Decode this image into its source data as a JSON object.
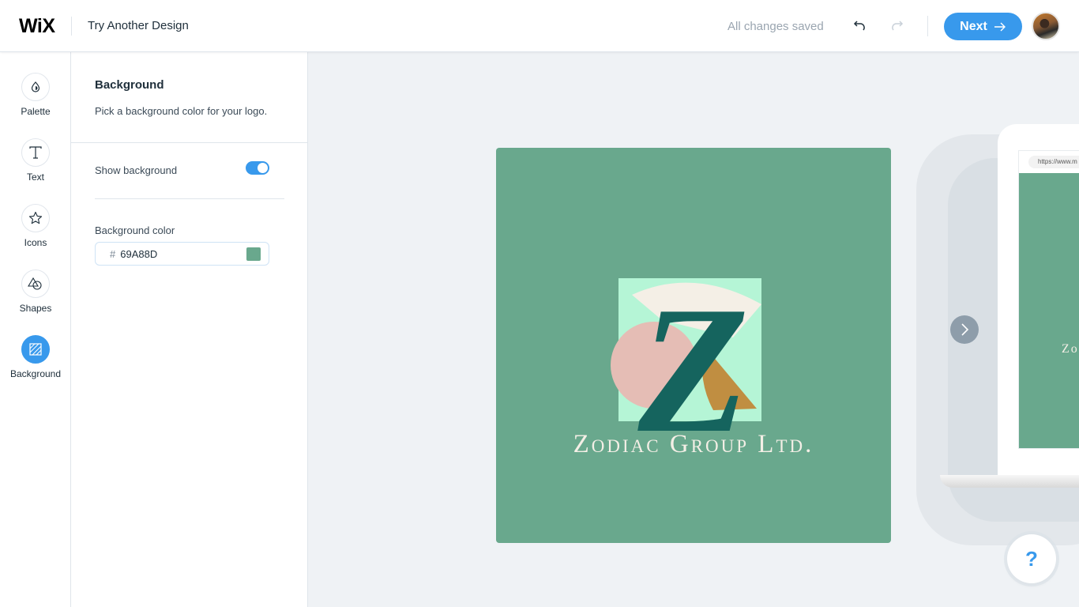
{
  "app": {
    "brand": "WiX",
    "page_title": "Try Another Design"
  },
  "topbar": {
    "save_status": "All changes saved",
    "undo_icon": "undo-icon",
    "redo_icon": "redo-icon",
    "next_label": "Next",
    "next_icon": "arrow-right-icon",
    "avatar": "user-avatar"
  },
  "sidebar": {
    "items": [
      {
        "label": "Palette",
        "icon": "palette-drop-icon",
        "active": false
      },
      {
        "label": "Text",
        "icon": "text-icon",
        "active": false
      },
      {
        "label": "Icons",
        "icon": "star-icon",
        "active": false
      },
      {
        "label": "Shapes",
        "icon": "shapes-icon",
        "active": false
      },
      {
        "label": "Background",
        "icon": "background-hatch-icon",
        "active": true
      }
    ]
  },
  "panel": {
    "title": "Background",
    "description": "Pick a background color for your logo.",
    "show_background_label": "Show background",
    "show_background_on": true,
    "background_color_label": "Background color",
    "hash": "#",
    "background_color_value": "69A88D"
  },
  "colors": {
    "accent": "#3899ec",
    "logo_background": "#69A88D",
    "logo_square": "#b5f5d6",
    "logo_fan": "#f4efe6",
    "logo_circle": "#e5bdb5",
    "logo_triangle": "#c08e41",
    "logo_letter": "#15645e",
    "logo_text": "#f4efe6"
  },
  "logo": {
    "letter": "Z",
    "brand_name": "Zodiac Group Ltd."
  },
  "preview": {
    "url": "https://www.m",
    "mini_brand": "Zo"
  },
  "carousel": {
    "next_icon": "chevron-right-icon"
  },
  "help": {
    "label": "?"
  }
}
